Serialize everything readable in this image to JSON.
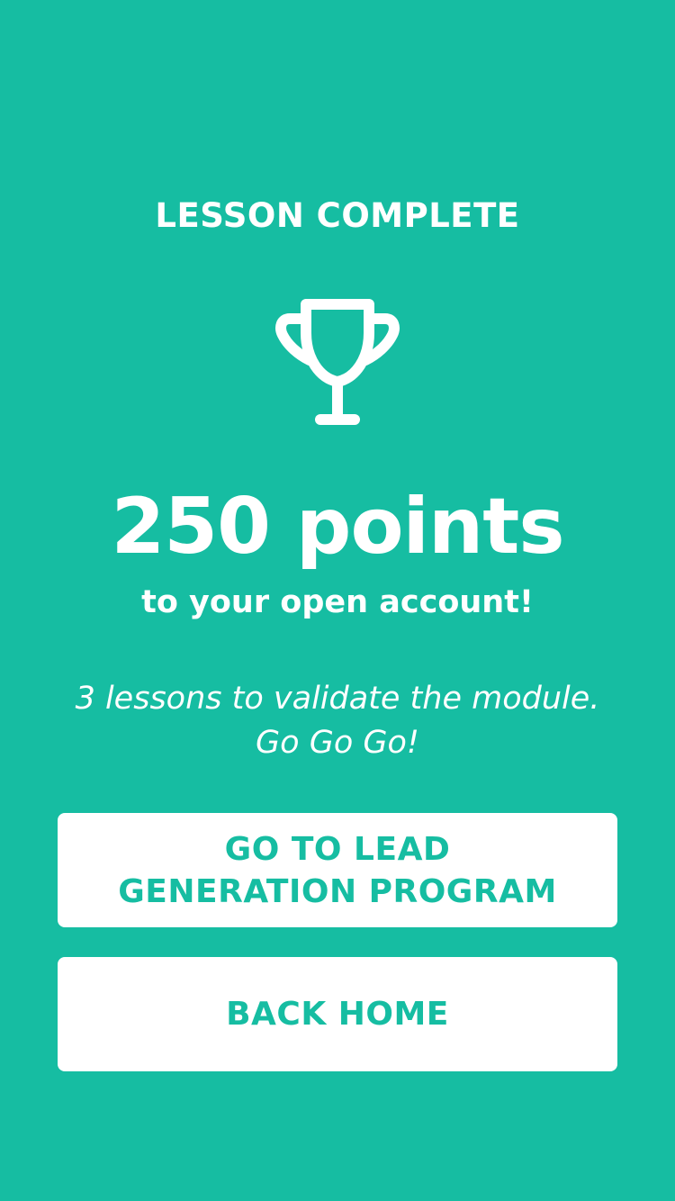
{
  "screen": {
    "title": "LESSON COMPLETE",
    "icon": "trophy-icon",
    "points": "250 points",
    "points_subtitle": "to your open account!",
    "message_lines": [
      "3 lessons to validate the module.",
      "Go Go Go!"
    ]
  },
  "buttons": {
    "primary_lines": [
      "GO TO LEAD",
      "GENERATION PROGRAM"
    ],
    "secondary": "BACK HOME"
  },
  "colors": {
    "background": "#16BDA2",
    "text": "#FFFFFF",
    "button_bg": "#FFFFFF",
    "button_text": "#16BDA2"
  }
}
